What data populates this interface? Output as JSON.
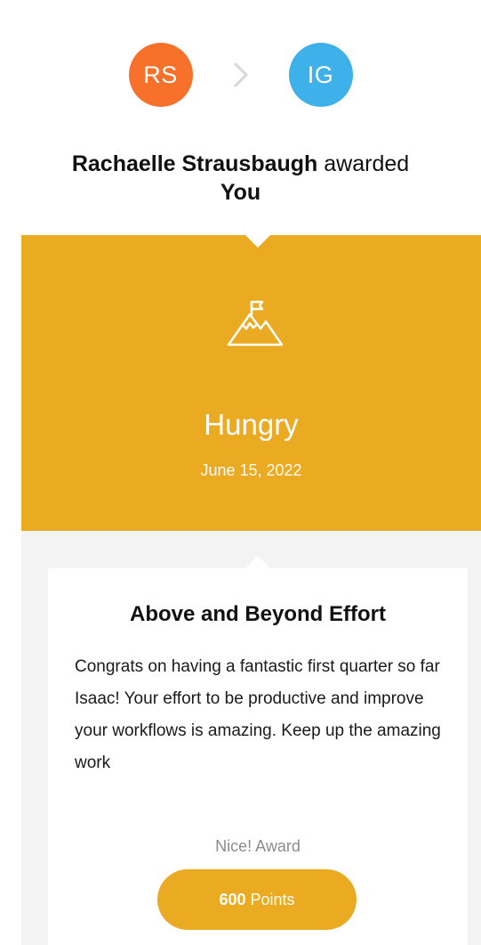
{
  "giver": {
    "initials": "RS",
    "name": "Rachaelle Strausbaugh",
    "color": "#F7712B"
  },
  "receiver": {
    "initials": "IG",
    "label": "You",
    "color": "#3FB1EA"
  },
  "headline": {
    "verb": "awarded"
  },
  "award": {
    "icon": "mountain-flag-icon",
    "name": "Hungry",
    "date": "June 15, 2022",
    "banner_color": "#EAAB22"
  },
  "card": {
    "title": "Above and Beyond Effort",
    "message": "Congrats on having a fantastic first quarter so far Isaac! Your effort to be productive and improve your workflows is amazing. Keep up the amazing work",
    "award_type": "Nice! Award",
    "points": {
      "value": "600",
      "unit": "Points"
    }
  }
}
